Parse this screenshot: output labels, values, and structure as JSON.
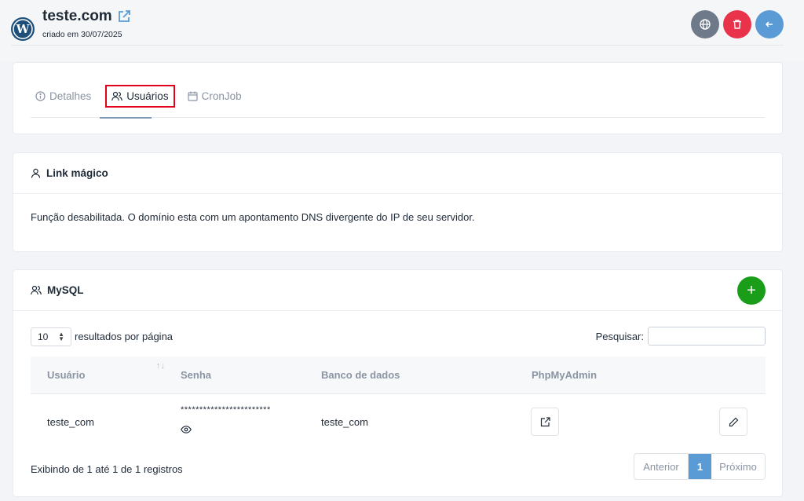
{
  "header": {
    "title": "teste.com",
    "created": "criado em 30/07/2025",
    "logo_icon": "wordpress-icon",
    "external_link_icon": "external-link-icon",
    "actions": [
      {
        "name": "globe-button",
        "icon": "globe-icon",
        "color": "#6e7a8a"
      },
      {
        "name": "delete-button",
        "icon": "trash-icon",
        "color": "#e8334a"
      },
      {
        "name": "back-button",
        "icon": "arrow-left-icon",
        "color": "#5a9bd5"
      }
    ]
  },
  "tabs": [
    {
      "label": "Detalhes",
      "icon": "info-icon",
      "active": false
    },
    {
      "label": "Usuários",
      "icon": "users-icon",
      "active": true
    },
    {
      "label": "CronJob",
      "icon": "calendar-icon",
      "active": false
    }
  ],
  "magic_link": {
    "title": "Link mágico",
    "icon": "user-icon",
    "message": "Função desabilitada. O domínio esta com um apontamento DNS divergente do IP de seu servidor."
  },
  "mysql": {
    "title": "MySQL",
    "icon": "users-icon",
    "add_label": "+",
    "add_color": "#1a9e1a",
    "page_length": "10",
    "page_length_label": "resultados por página",
    "search_label": "Pesquisar:",
    "search_value": "",
    "columns": [
      "Usuário",
      "Senha",
      "Banco de dados",
      "PhpMyAdmin"
    ],
    "rows": [
      {
        "user": "teste_com",
        "password": "************************",
        "database": "teste_com"
      }
    ],
    "info": "Exibindo de 1 até 1 de 1 registros",
    "pagination": {
      "prev": "Anterior",
      "current": "1",
      "next": "Próximo",
      "active_color": "#5a9bd5"
    }
  }
}
